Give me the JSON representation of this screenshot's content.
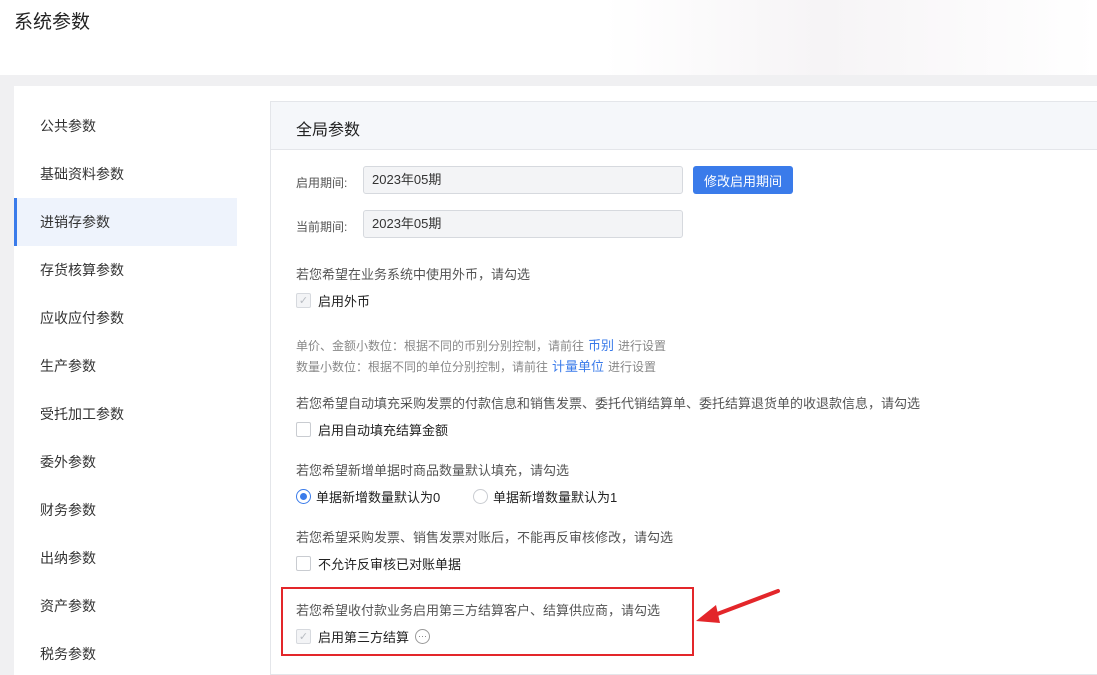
{
  "page": {
    "title": "系统参数"
  },
  "sidebar": {
    "items": [
      {
        "label": "公共参数"
      },
      {
        "label": "基础资料参数"
      },
      {
        "label": "进销存参数",
        "active": true
      },
      {
        "label": "存货核算参数"
      },
      {
        "label": "应收应付参数"
      },
      {
        "label": "生产参数"
      },
      {
        "label": "受托加工参数"
      },
      {
        "label": "委外参数"
      },
      {
        "label": "财务参数"
      },
      {
        "label": "出纳参数"
      },
      {
        "label": "资产参数"
      },
      {
        "label": "税务参数"
      }
    ]
  },
  "panel": {
    "title": "全局参数",
    "start_period_label": "启用期间:",
    "start_period_value": "2023年05期",
    "modify_button": "修改启用期间",
    "current_period_label": "当前期间:",
    "current_period_value": "2023年05期",
    "foreign_currency": {
      "question": "若您希望在业务系统中使用外币，请勾选",
      "option": "启用外币",
      "checked": true
    },
    "notes": {
      "price_prefix": "单价、金额小数位：根据不同的币别分别控制，请前往",
      "price_link": "币别",
      "price_suffix": "进行设置",
      "qty_prefix": "数量小数位：根据不同的单位分别控制，请前往",
      "qty_link": "计量单位",
      "qty_suffix": "进行设置"
    },
    "auto_fill": {
      "question": "若您希望自动填充采购发票的付款信息和销售发票、委托代销结算单、委托结算退货单的收退款信息，请勾选",
      "option": "启用自动填充结算金额",
      "checked": false
    },
    "default_qty": {
      "question": "若您希望新增单据时商品数量默认填充，请勾选",
      "option_0": "单据新增数量默认为0",
      "option_1": "单据新增数量默认为1",
      "selected": "option_0"
    },
    "no_reverse": {
      "question": "若您希望采购发票、销售发票对账后，不能再反审核修改，请勾选",
      "option": "不允许反审核已对账单据",
      "checked": false
    },
    "third_party": {
      "question": "若您希望收付款业务启用第三方结算客户、结算供应商，请勾选",
      "option": "启用第三方结算",
      "checked": true,
      "more_icon": "ellipsis-circle-icon"
    }
  },
  "colors": {
    "accent": "#3a7bea",
    "highlight": "#e3262a"
  }
}
